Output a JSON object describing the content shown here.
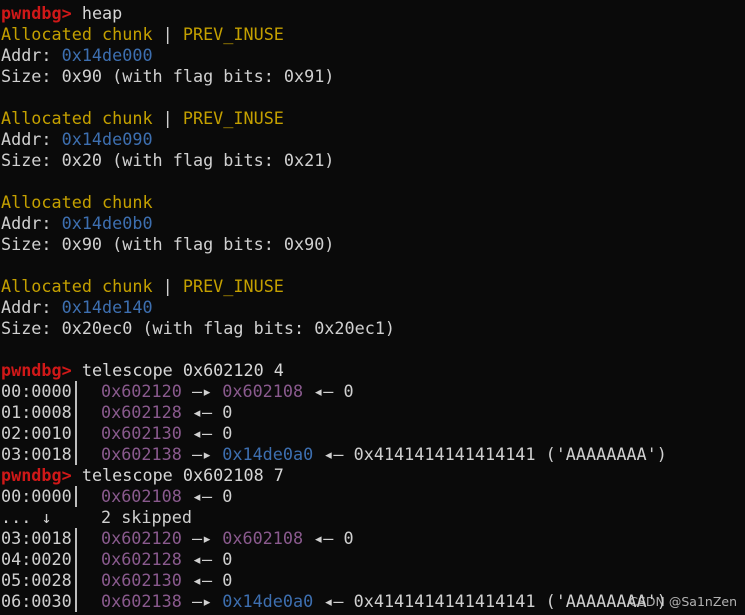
{
  "prompt": "pwndbg>",
  "heap_cmd": "heap",
  "labels": {
    "addr": "Addr: ",
    "size": "Size: ",
    "sep": " | "
  },
  "chunks": [
    {
      "type": "Allocated chunk",
      "flag": "PREV_INUSE",
      "addr": "0x14de000",
      "size": "0x90 (with flag bits: 0x91)"
    },
    {
      "type": "Allocated chunk",
      "flag": "PREV_INUSE",
      "addr": "0x14de090",
      "size": "0x20 (with flag bits: 0x21)"
    },
    {
      "type": "Allocated chunk",
      "flag": "",
      "addr": "0x14de0b0",
      "size": "0x90 (with flag bits: 0x90)"
    },
    {
      "type": "Allocated chunk",
      "flag": "PREV_INUSE",
      "addr": "0x14de140",
      "size": "0x20ec0 (with flag bits: 0x20ec1)"
    }
  ],
  "arrows": {
    "right": "—▸",
    "left": "◂—"
  },
  "telescope1": {
    "cmd": "telescope 0x602120 4",
    "rows": [
      {
        "idx": "00:0000",
        "addr": "0x602120",
        "ptr": "0x602108",
        "ptr_color": "purple",
        "val": "0"
      },
      {
        "idx": "01:0008",
        "addr": "0x602128",
        "ptr": "",
        "val": "0"
      },
      {
        "idx": "02:0010",
        "addr": "0x602130",
        "ptr": "",
        "val": "0"
      },
      {
        "idx": "03:0018",
        "addr": "0x602138",
        "ptr": "0x14de0a0",
        "ptr_color": "blue",
        "val": "0x4141414141414141 ('AAAAAAAA')"
      }
    ]
  },
  "telescope2": {
    "cmd": "telescope 0x602108 7",
    "row0": {
      "idx": "00:0000",
      "addr": "0x602108",
      "val": "0"
    },
    "skipped": {
      "idx": "... ↓",
      "text": "2 skipped"
    },
    "rows": [
      {
        "idx": "03:0018",
        "addr": "0x602120",
        "ptr": "0x602108",
        "ptr_color": "purple",
        "val": "0"
      },
      {
        "idx": "04:0020",
        "addr": "0x602128",
        "ptr": "",
        "val": "0"
      },
      {
        "idx": "05:0028",
        "addr": "0x602130",
        "ptr": "",
        "val": "0"
      },
      {
        "idx": "06:0030",
        "addr": "0x602138",
        "ptr": "0x14de0a0",
        "ptr_color": "blue",
        "val": "0x4141414141414141 ('AAAAAAAA')"
      }
    ]
  },
  "watermark": "CSDN @Sa1nZen"
}
